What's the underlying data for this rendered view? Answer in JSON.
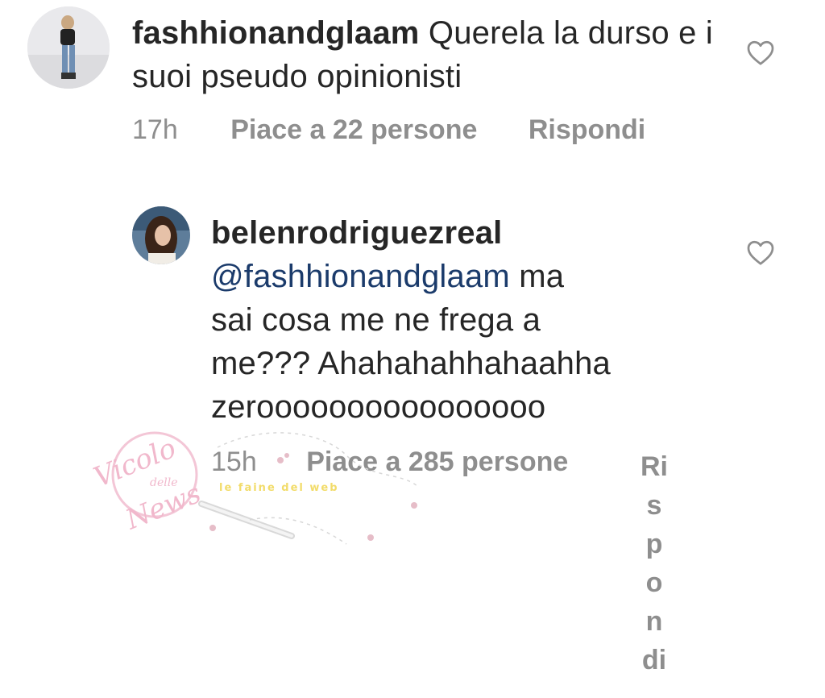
{
  "comments": [
    {
      "username": "fashhionandglaam",
      "text": "Querela la durso e i suoi pseudo opinionisti",
      "time": "17h",
      "likes": "Piace a 22 persone",
      "reply": "Rispondi"
    },
    {
      "username": "belenrodriguezreal",
      "mention": "@fashhionandglaam",
      "text_line1": " ma",
      "text_line2": "sai cosa me ne frega a",
      "text_line3": "me??? Ahahahahhahaahha",
      "text_line4": "zeroooooooooooooooo",
      "time": "15h",
      "likes": "Piace a 285 persone",
      "reply": "Rispondi"
    }
  ],
  "watermark": {
    "line1": "Vicolo",
    "line2": "delle",
    "line3": "News",
    "tagline": "le faine del web"
  },
  "icons": {
    "like": "heart-outline-icon"
  },
  "colors": {
    "text": "#262626",
    "meta": "#8e8e8e",
    "mention": "#1b3b6b",
    "watermark": "#f1b8cc"
  }
}
